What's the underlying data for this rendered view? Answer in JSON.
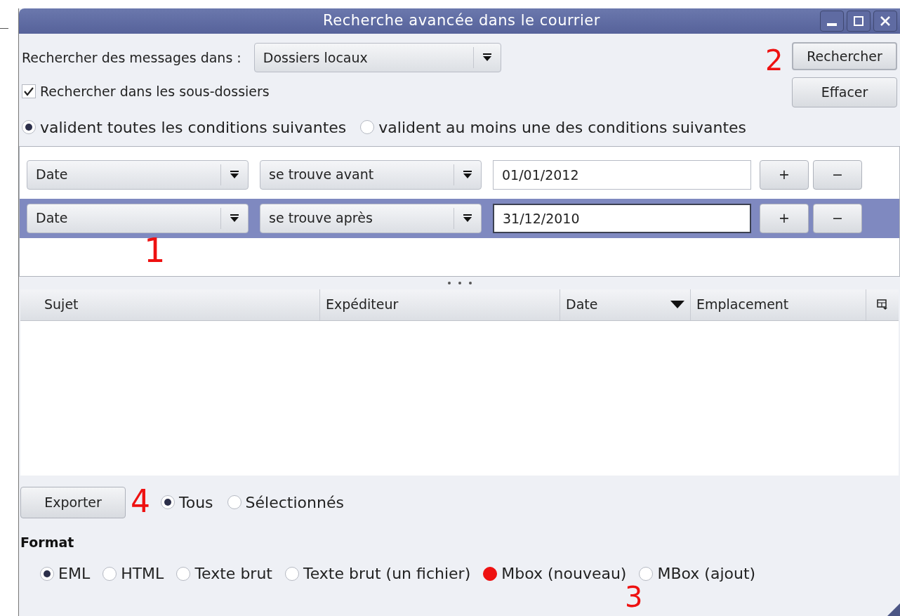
{
  "window": {
    "title": "Recherche avancée dans le courrier"
  },
  "search_in": {
    "label": "Rechercher des messages dans :",
    "value": "Dossiers locaux"
  },
  "subfolders": {
    "label": "Rechercher dans les sous-dossiers",
    "checked": true
  },
  "match": [
    {
      "label": "valident toutes les conditions suivantes",
      "selected": true
    },
    {
      "label": "valident au moins une des conditions suivantes",
      "selected": false
    }
  ],
  "buttons": {
    "search": "Rechercher",
    "clear": "Effacer"
  },
  "conditions": [
    {
      "field": "Date",
      "operator": "se trouve avant",
      "value": "01/01/2012",
      "add": "+",
      "remove": "−",
      "selected": false
    },
    {
      "field": "Date",
      "operator": "se trouve après",
      "value": "31/12/2010",
      "add": "+",
      "remove": "−",
      "selected": true
    }
  ],
  "table": {
    "columns": [
      {
        "label": "Sujet",
        "sorted": false
      },
      {
        "label": "Expéditeur",
        "sorted": false
      },
      {
        "label": "Date",
        "sorted": true
      },
      {
        "label": "Emplacement",
        "sorted": false
      }
    ]
  },
  "export": {
    "button": "Exporter",
    "scope": [
      {
        "label": "Tous",
        "selected": true
      },
      {
        "label": "Sélectionnés",
        "selected": false
      }
    ]
  },
  "format": {
    "title": "Format",
    "options": [
      {
        "label": "EML",
        "selected": true,
        "highlighted": false
      },
      {
        "label": "HTML",
        "selected": false,
        "highlighted": false
      },
      {
        "label": "Texte brut",
        "selected": false,
        "highlighted": false
      },
      {
        "label": "Texte brut (un fichier)",
        "selected": false,
        "highlighted": false
      },
      {
        "label": "Mbox (nouveau)",
        "selected": false,
        "highlighted": true
      },
      {
        "label": "MBox (ajout)",
        "selected": false,
        "highlighted": false
      }
    ]
  },
  "annotations": [
    {
      "label": "1"
    },
    {
      "label": "2"
    },
    {
      "label": "3"
    },
    {
      "label": "4"
    }
  ]
}
